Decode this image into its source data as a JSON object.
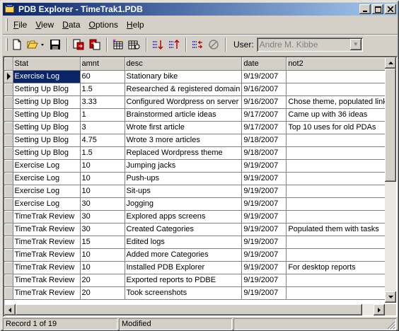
{
  "window": {
    "title": "PDB Explorer - TimeTrak1.PDB"
  },
  "menu": [
    {
      "label": "File",
      "u": "F",
      "rest": "ile"
    },
    {
      "label": "View",
      "u": "V",
      "rest": "iew"
    },
    {
      "label": "Data",
      "u": "D",
      "rest": "ata"
    },
    {
      "label": "Options",
      "u": "O",
      "rest": "ptions"
    },
    {
      "label": "Help",
      "u": "H",
      "rest": "elp"
    }
  ],
  "toolbar": {
    "user_label": "User:",
    "user_value": "Andre M. Kibbe"
  },
  "grid": {
    "columns": [
      "Stat",
      "amnt",
      "desc",
      "date",
      "not2"
    ],
    "rows": [
      [
        "Exercise Log",
        "60",
        "Stationary bike",
        "9/19/2007",
        ""
      ],
      [
        "Setting Up Blog",
        "1.5",
        "Researched & registered domain",
        "9/16/2007",
        ""
      ],
      [
        "Setting Up Blog",
        "3.33",
        "Configured Wordpress on server",
        "9/16/2007",
        "Chose theme, populated links"
      ],
      [
        "Setting Up Blog",
        "1",
        "Brainstormed article ideas",
        "9/17/2007",
        "Came up with 36 ideas"
      ],
      [
        "Setting Up Blog",
        "3",
        "Wrote first article",
        "9/17/2007",
        "Top 10 uses for old PDAs"
      ],
      [
        "Setting Up Blog",
        "4.75",
        "Wrote 3 more articles",
        "9/18/2007",
        ""
      ],
      [
        "Setting Up Blog",
        "1.5",
        "Replaced Wordpress theme",
        "9/18/2007",
        ""
      ],
      [
        "Exercise Log",
        "10",
        "Jumping jacks",
        "9/19/2007",
        ""
      ],
      [
        "Exercise Log",
        "10",
        "Push-ups",
        "9/19/2007",
        ""
      ],
      [
        "Exercise Log",
        "10",
        "Sit-ups",
        "9/19/2007",
        ""
      ],
      [
        "Exercise Log",
        "30",
        "Jogging",
        "9/19/2007",
        ""
      ],
      [
        "TimeTrak Review",
        "30",
        "Explored apps screens",
        "9/19/2007",
        ""
      ],
      [
        "TimeTrak Review",
        "30",
        "Created Categories",
        "9/19/2007",
        "Populated them with tasks"
      ],
      [
        "TimeTrak Review",
        "15",
        "Edited logs",
        "9/19/2007",
        ""
      ],
      [
        "TimeTrak Review",
        "10",
        "Added more Categories",
        "9/19/2007",
        ""
      ],
      [
        "TimeTrak Review",
        "10",
        "Installed PDB Explorer",
        "9/19/2007",
        "For desktop reports"
      ],
      [
        "TimeTrak Review",
        "20",
        "Exported reports to PDBE",
        "9/19/2007",
        ""
      ],
      [
        "TimeTrak Review",
        "20",
        "Took screenshots",
        "9/19/2007",
        ""
      ]
    ]
  },
  "status": {
    "record": "Record 1 of 19",
    "state": "Modified"
  },
  "colors": {
    "title_start": "#0a246a",
    "title_end": "#a6caf0",
    "selection": "#0a246a",
    "face": "#d4d0c8"
  }
}
